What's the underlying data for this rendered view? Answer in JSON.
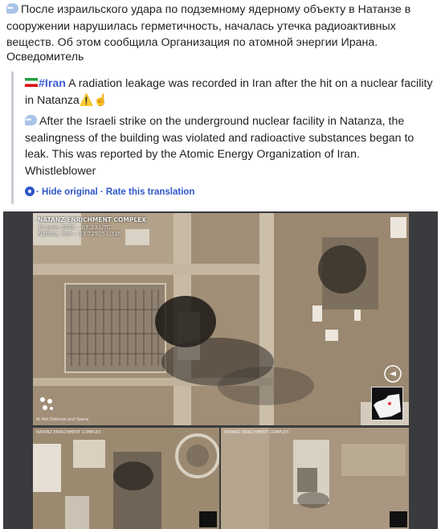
{
  "post": {
    "original_text": "После израильского удара по подземному ядерному объекту в Натанзе в сооружении нарушилась герметичность, началась утечка радиоактивных веществ. Об этом сообщила Организация по атомной энергии Ирана.",
    "signature": "Осведомитель"
  },
  "translation": {
    "hashtag": "#Iran",
    "headline": " A radiation leakage was recorded in Iran after the hit on a nuclear facility in Natanza",
    "headline_emoji": "⚠️☝️",
    "paragraph": "After the Israeli strike on the underground nuclear facility in Natanza, the sealingness of the building was violated and radioactive substances began to leak. This was reported by the Atomic Energy Organization of Iran.",
    "signature": "Whistleblower",
    "hide_original": "· Hide original",
    "separator": " · ",
    "rate_translation": "Rate this translation"
  },
  "image": {
    "title": "NATANZ ENRICHMENT COMPLEX",
    "date": "13 June 2025 – 07:23 UTC",
    "coords": "Natanz, Iran – 33.725, 51.726",
    "logo_text": "AI Hot Defense and Space",
    "sub_left_caption": "NATANZ ENRICHMENT COMPLEX",
    "sub_right_caption": "NATANZ ENRICHMENT COMPLEX"
  },
  "colors": {
    "link": "#2f56c9",
    "hashtag": "#3b5cd8",
    "quote_border": "#c9cdd3"
  },
  "icons": {
    "speech": "speech-bubble-icon",
    "flag": "iran-flag-icon",
    "settings": "translate-settings-icon"
  }
}
